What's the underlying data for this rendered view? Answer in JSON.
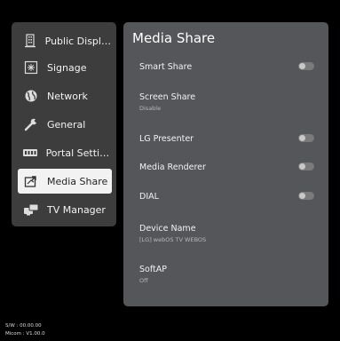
{
  "sidebar": {
    "items": [
      {
        "label": "Public Display...",
        "icon": "building-icon",
        "active": false
      },
      {
        "label": "Signage",
        "icon": "signage-icon",
        "active": false
      },
      {
        "label": "Network",
        "icon": "globe-icon",
        "active": false
      },
      {
        "label": "General",
        "icon": "wrench-icon",
        "active": false
      },
      {
        "label": "Portal Settings",
        "icon": "portal-icon",
        "active": false
      },
      {
        "label": "Media Share",
        "icon": "media-share-icon",
        "active": true
      },
      {
        "label": "TV Manager",
        "icon": "tv-manager-icon",
        "active": false
      }
    ]
  },
  "panel": {
    "title": "Media Share",
    "rows": [
      {
        "label": "Smart Share",
        "toggle": true,
        "state": "off"
      },
      {
        "label": "Screen Share",
        "value": "Disable"
      },
      {
        "label": "LG Presenter",
        "toggle": true,
        "state": "off"
      },
      {
        "label": "Media Renderer",
        "toggle": true,
        "state": "off"
      },
      {
        "label": "DIAL",
        "toggle": true,
        "state": "off"
      },
      {
        "label": "Device Name",
        "value": "[LG] webOS TV WEBOS"
      },
      {
        "label": "SoftAP",
        "value": "Off"
      }
    ]
  },
  "footer": {
    "sw": "S/W : 00.00.00",
    "micom": "Micom : V1.00.0"
  }
}
